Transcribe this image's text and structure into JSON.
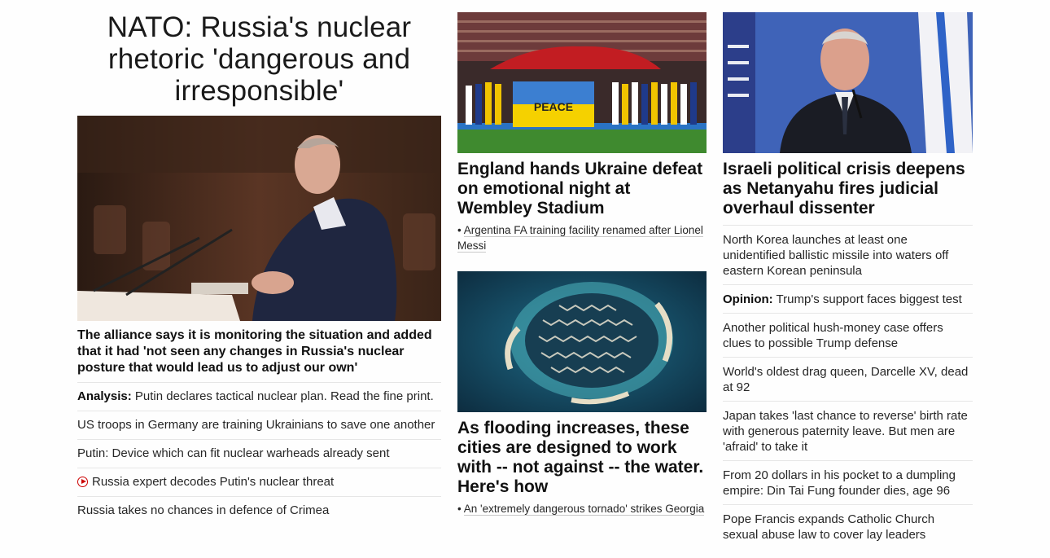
{
  "left": {
    "headline": "NATO: Russia's nuclear rhetoric 'dangerous and irresponsible'",
    "summary": "The alliance says it is monitoring the situation and added that it had 'not seen any changes in Russia's nuclear posture that would lead us to adjust our own'",
    "links": [
      {
        "prefix": "Analysis:",
        "text": " Putin declares tactical nuclear plan. Read the fine print."
      },
      {
        "prefix": "",
        "text": "US troops in Germany are training Ukrainians to save one another"
      },
      {
        "prefix": "",
        "text": "Putin: Device which can fit nuclear warheads already sent"
      },
      {
        "prefix": "",
        "text": "Russia expert decodes Putin's nuclear threat",
        "icon": "play-icon"
      },
      {
        "prefix": "",
        "text": "Russia takes no chances in defence of Crimea"
      }
    ]
  },
  "middle": {
    "card1": {
      "image_banner": "PEACE",
      "headline": "England hands Ukraine defeat on emotional night at Wembley Stadium",
      "sublink_bullet": "•",
      "sublink": "Argentina FA training facility renamed after Lionel Messi"
    },
    "card2": {
      "headline": "As flooding increases, these cities are designed to work with -- not against -- the water. Here's how",
      "sublink_bullet": "•",
      "sublink": "An 'extremely dangerous tornado' strikes Georgia"
    }
  },
  "right": {
    "headline": "Israeli political crisis deepens as Netanyahu fires judicial overhaul dissenter",
    "links": [
      {
        "prefix": "",
        "text": "North Korea launches at least one unidentified ballistic missile into waters off eastern Korean peninsula"
      },
      {
        "prefix": "Opinion:",
        "text": " Trump's support faces biggest test"
      },
      {
        "prefix": "",
        "text": "Another political hush-money case offers clues to possible Trump defense"
      },
      {
        "prefix": "",
        "text": "World's oldest drag queen, Darcelle XV, dead at 92"
      },
      {
        "prefix": "",
        "text": "Japan takes 'last chance to reverse' birth rate with generous paternity leave. But men are 'afraid' to take it"
      },
      {
        "prefix": "",
        "text": "From 20 dollars in his pocket to a dumpling empire: Din Tai Fung founder dies, age 96"
      },
      {
        "prefix": "",
        "text": "Pope Francis expands Catholic Church sexual abuse law to cover lay leaders"
      }
    ]
  },
  "colors": {
    "link_text": "#262626",
    "divider": "#e6e6e6",
    "video_accent": "#cc0000"
  }
}
